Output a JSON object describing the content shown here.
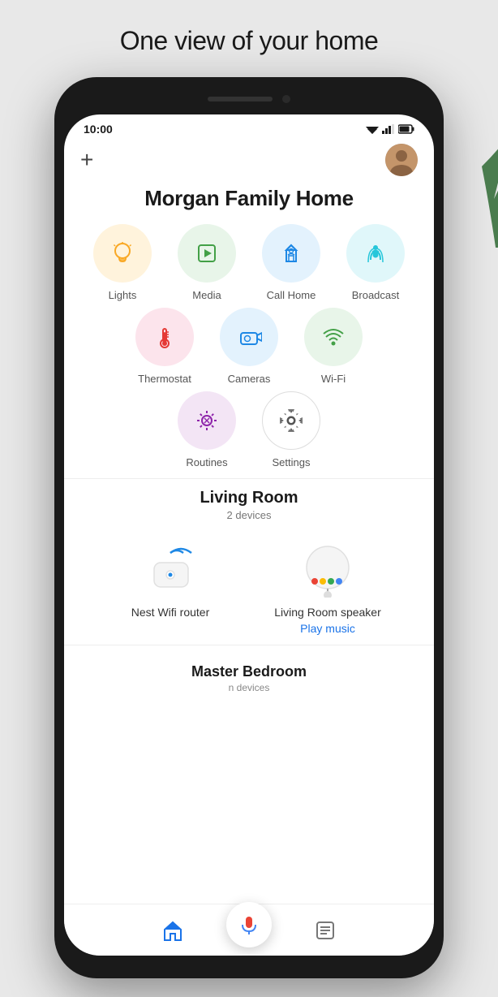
{
  "page": {
    "title": "One view of your home"
  },
  "status": {
    "time": "10:00"
  },
  "header": {
    "add_label": "+",
    "home_title": "Morgan Family Home"
  },
  "grid": {
    "row1": [
      {
        "id": "lights",
        "label": "Lights",
        "color": "yellow",
        "icon": "bulb"
      },
      {
        "id": "media",
        "label": "Media",
        "color": "green",
        "icon": "play"
      },
      {
        "id": "call-home",
        "label": "Call Home",
        "color": "blue",
        "icon": "call"
      },
      {
        "id": "broadcast",
        "label": "Broadcast",
        "color": "teal",
        "icon": "broadcast"
      }
    ],
    "row2": [
      {
        "id": "thermostat",
        "label": "Thermostat",
        "color": "pink",
        "icon": "thermometer"
      },
      {
        "id": "cameras",
        "label": "Cameras",
        "color": "blue2",
        "icon": "camera"
      },
      {
        "id": "wifi",
        "label": "Wi-Fi",
        "color": "green2",
        "icon": "wifi"
      }
    ],
    "row3": [
      {
        "id": "routines",
        "label": "Routines",
        "color": "purple",
        "icon": "sun"
      },
      {
        "id": "settings",
        "label": "Settings",
        "color": "white",
        "icon": "gear"
      }
    ]
  },
  "rooms": [
    {
      "id": "living-room",
      "name": "Living Room",
      "device_count": "2 devices",
      "devices": [
        {
          "id": "nest-wifi",
          "name": "Nest Wifi router",
          "type": "router"
        },
        {
          "id": "lr-speaker",
          "name": "Living Room speaker",
          "type": "speaker",
          "action_label": "Play music"
        }
      ]
    },
    {
      "id": "master-bedroom",
      "name": "Master Bedroom",
      "device_count": "n devices"
    }
  ],
  "bottom_nav": {
    "home_icon": "home",
    "list_icon": "list"
  },
  "fab": {
    "icon": "mic"
  }
}
